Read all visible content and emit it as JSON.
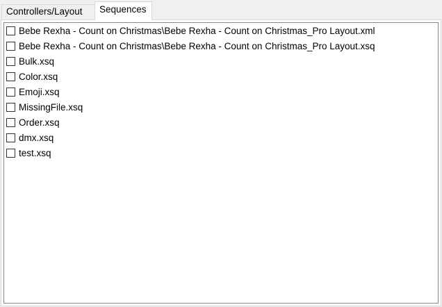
{
  "tabs": [
    {
      "label": "Controllers/Layout",
      "selected": false
    },
    {
      "label": "Sequences",
      "selected": true
    }
  ],
  "sequences": {
    "items": [
      {
        "label": "Bebe Rexha - Count on Christmas\\Bebe Rexha - Count on Christmas_Pro Layout.xml",
        "checked": false
      },
      {
        "label": "Bebe Rexha - Count on Christmas\\Bebe Rexha - Count on Christmas_Pro Layout.xsq",
        "checked": false
      },
      {
        "label": "Bulk.xsq",
        "checked": false
      },
      {
        "label": "Color.xsq",
        "checked": false
      },
      {
        "label": "Emoji.xsq",
        "checked": false
      },
      {
        "label": "MissingFile.xsq",
        "checked": false
      },
      {
        "label": "Order.xsq",
        "checked": false
      },
      {
        "label": "dmx.xsq",
        "checked": false
      },
      {
        "label": "test.xsq",
        "checked": false
      }
    ]
  }
}
